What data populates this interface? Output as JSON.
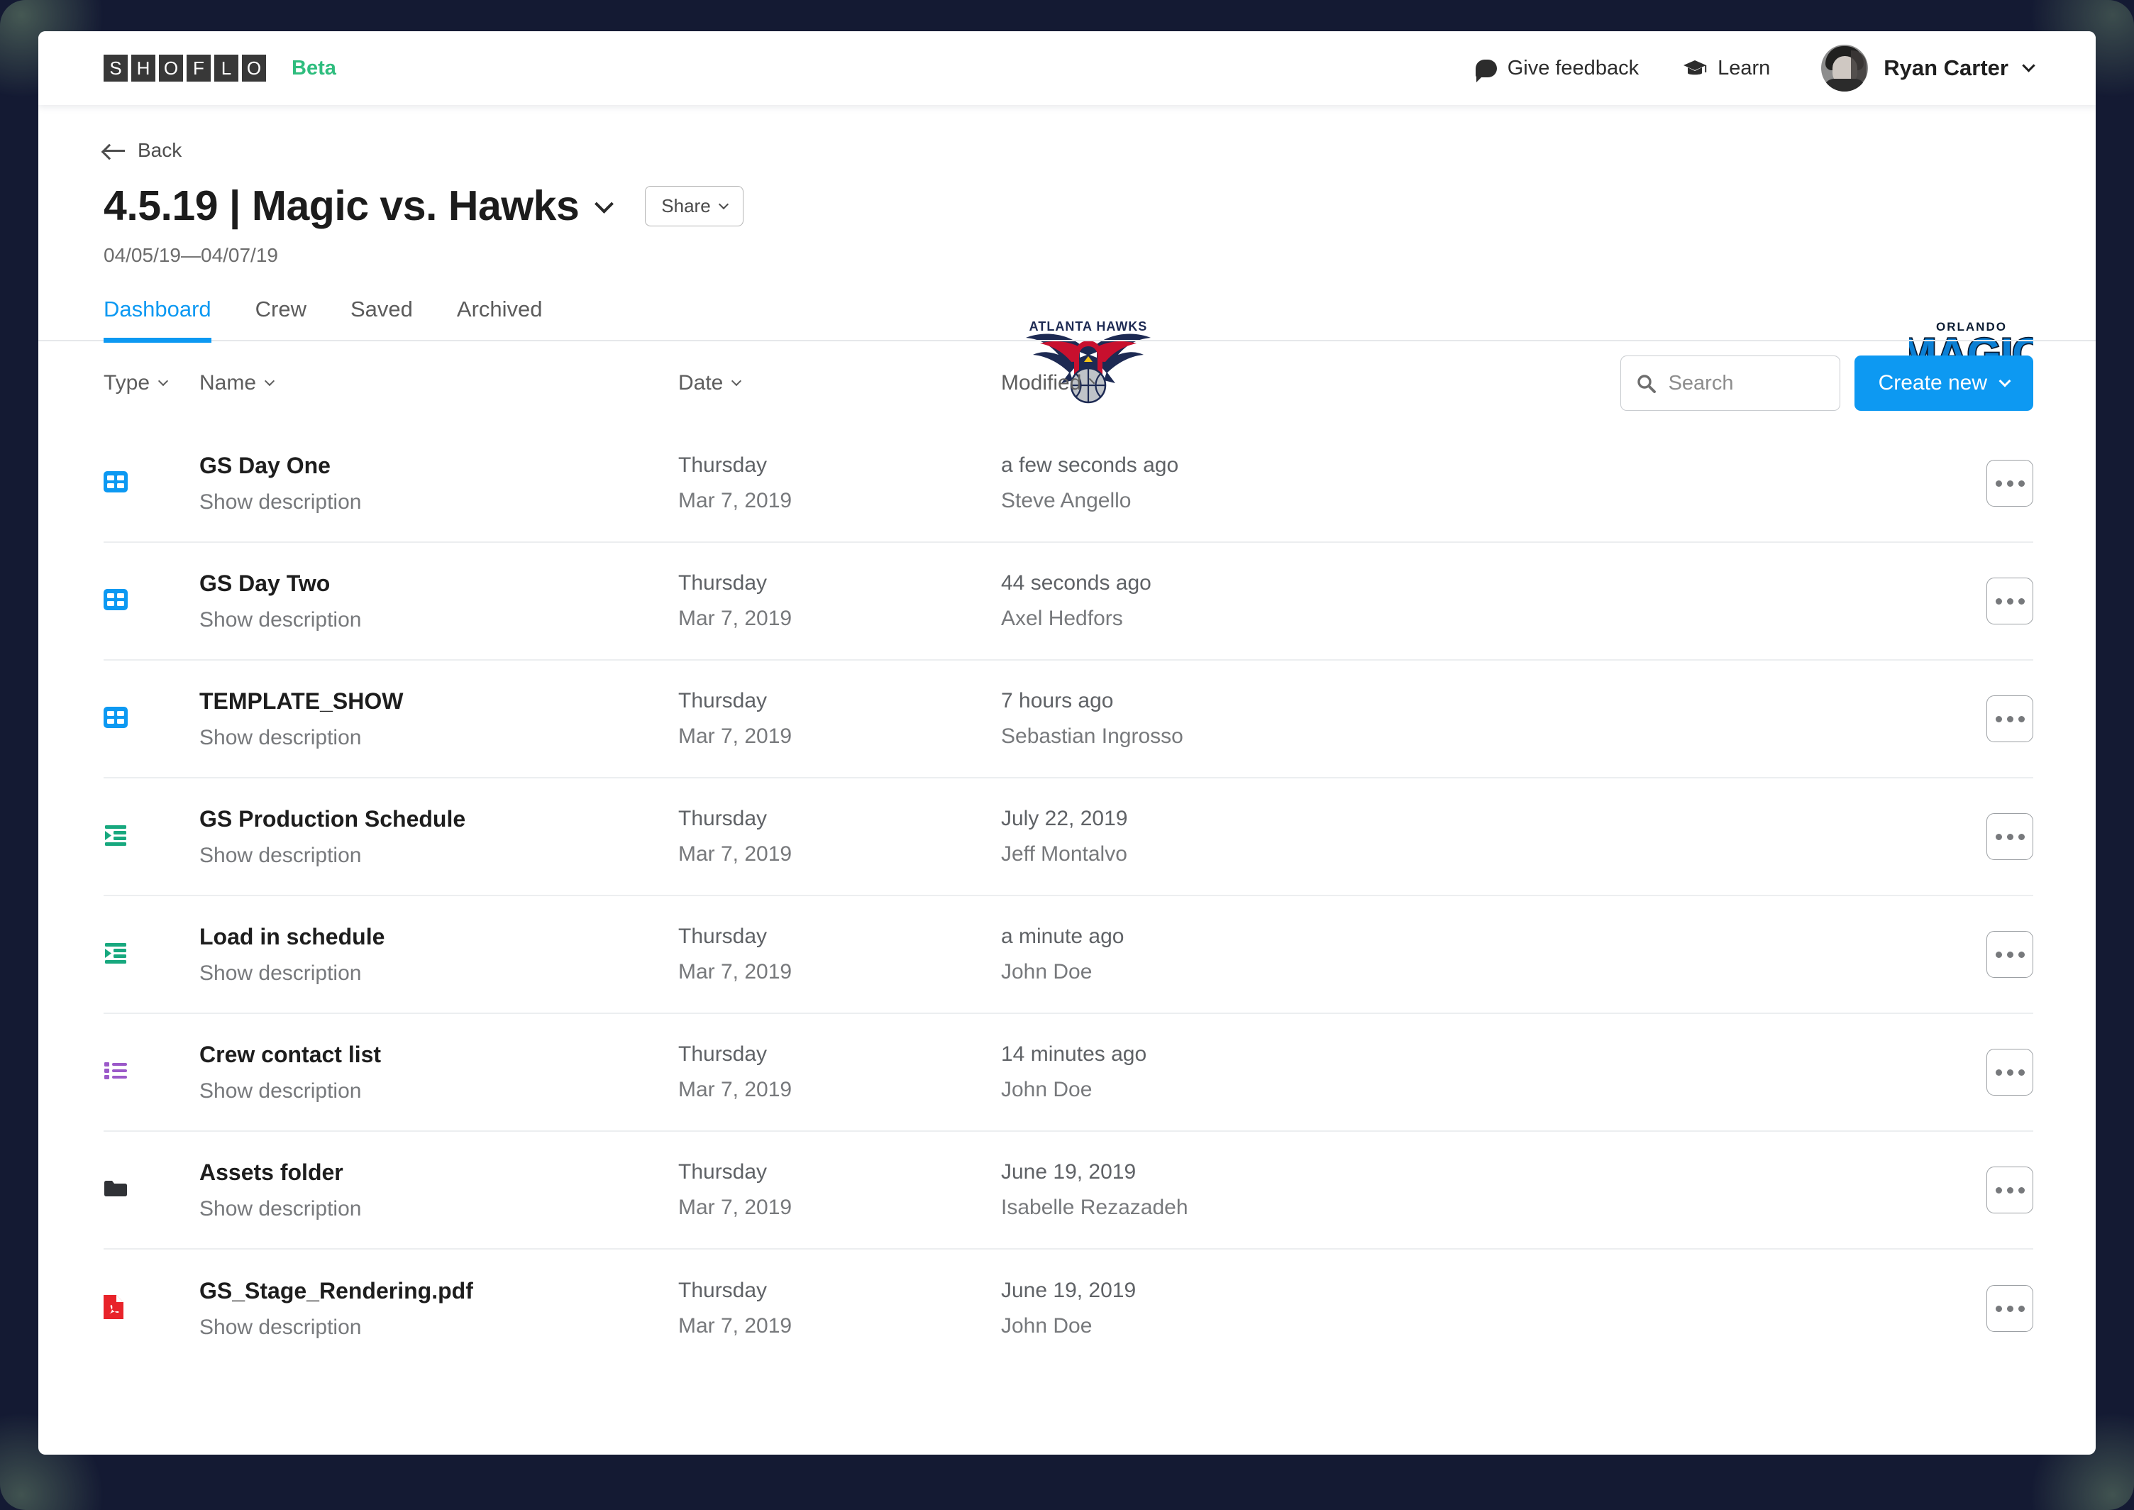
{
  "topbar": {
    "logo_letters": [
      "S",
      "H",
      "O",
      "F",
      "L",
      "O"
    ],
    "beta_label": "Beta",
    "feedback_label": "Give feedback",
    "learn_label": "Learn",
    "user_name": "Ryan Carter"
  },
  "header": {
    "back_label": "Back",
    "title": "4.5.19 | Magic vs. Hawks",
    "share_label": "Share",
    "date_range": "04/05/19—04/07/19",
    "home_team_logo": "atlanta-hawks-logo",
    "away_team_logo": "orlando-magic-logo",
    "hawks_text": "ATLANTA HAWKS",
    "magic_text_top": "ORLANDO",
    "magic_text_main": "MAGIC"
  },
  "tabs": [
    {
      "label": "Dashboard",
      "active": true
    },
    {
      "label": "Crew",
      "active": false
    },
    {
      "label": "Saved",
      "active": false
    },
    {
      "label": "Archived",
      "active": false
    }
  ],
  "toolbar": {
    "columns": [
      "Type",
      "Name",
      "Date",
      "Modified"
    ],
    "search_placeholder": "Search",
    "search_value": "",
    "create_label": "Create new"
  },
  "colors": {
    "accent_blue": "#0d99f2",
    "beta_green": "#2fbd7e",
    "frame_navy": "#141a33",
    "rundown_green": "#17a87e",
    "list_purple": "#9b59c9",
    "pdf_red": "#e8232a",
    "folder_dark": "#303236"
  },
  "rows": [
    {
      "icon": "show-grid-icon",
      "icon_kind": "grid",
      "name": "GS Day One",
      "description": "Show description",
      "date_day": "Thursday",
      "date_full": "Mar 7, 2019",
      "modified_when": "a few seconds ago",
      "modified_by": "Steve Angello",
      "menu": "row-menu"
    },
    {
      "icon": "show-grid-icon",
      "icon_kind": "grid",
      "name": "GS Day Two",
      "description": "Show description",
      "date_day": "Thursday",
      "date_full": "Mar 7, 2019",
      "modified_when": "44 seconds ago",
      "modified_by": "Axel Hedfors",
      "menu": "row-menu"
    },
    {
      "icon": "show-grid-icon",
      "icon_kind": "grid",
      "name": "TEMPLATE_SHOW",
      "description": "Show description",
      "date_day": "Thursday",
      "date_full": "Mar 7, 2019",
      "modified_when": "7 hours ago",
      "modified_by": "Sebastian Ingrosso",
      "menu": "row-menu"
    },
    {
      "icon": "rundown-icon",
      "icon_kind": "rundown",
      "name": "GS Production Schedule",
      "description": "Show description",
      "date_day": "Thursday",
      "date_full": "Mar 7, 2019",
      "modified_when": "July 22, 2019",
      "modified_by": "Jeff Montalvo",
      "menu": "row-menu"
    },
    {
      "icon": "rundown-icon",
      "icon_kind": "rundown",
      "name": "Load in schedule",
      "description": "Show description",
      "date_day": "Thursday",
      "date_full": "Mar 7, 2019",
      "modified_when": "a minute ago",
      "modified_by": "John Doe",
      "menu": "row-menu"
    },
    {
      "icon": "bullet-list-icon",
      "icon_kind": "list",
      "name": "Crew contact list",
      "description": "Show description",
      "date_day": "Thursday",
      "date_full": "Mar 7, 2019",
      "modified_when": "14 minutes ago",
      "modified_by": "John Doe",
      "menu": "row-menu"
    },
    {
      "icon": "folder-icon",
      "icon_kind": "folder",
      "name": "Assets folder",
      "description": "Show description",
      "date_day": "Thursday",
      "date_full": "Mar 7, 2019",
      "modified_when": "June 19, 2019",
      "modified_by": "Isabelle Rezazadeh",
      "menu": "row-menu"
    },
    {
      "icon": "pdf-file-icon",
      "icon_kind": "pdf",
      "name": "GS_Stage_Rendering.pdf",
      "description": "Show description",
      "date_day": "Thursday",
      "date_full": "Mar 7, 2019",
      "modified_when": "June 19, 2019",
      "modified_by": "John Doe",
      "menu": "row-menu"
    }
  ]
}
